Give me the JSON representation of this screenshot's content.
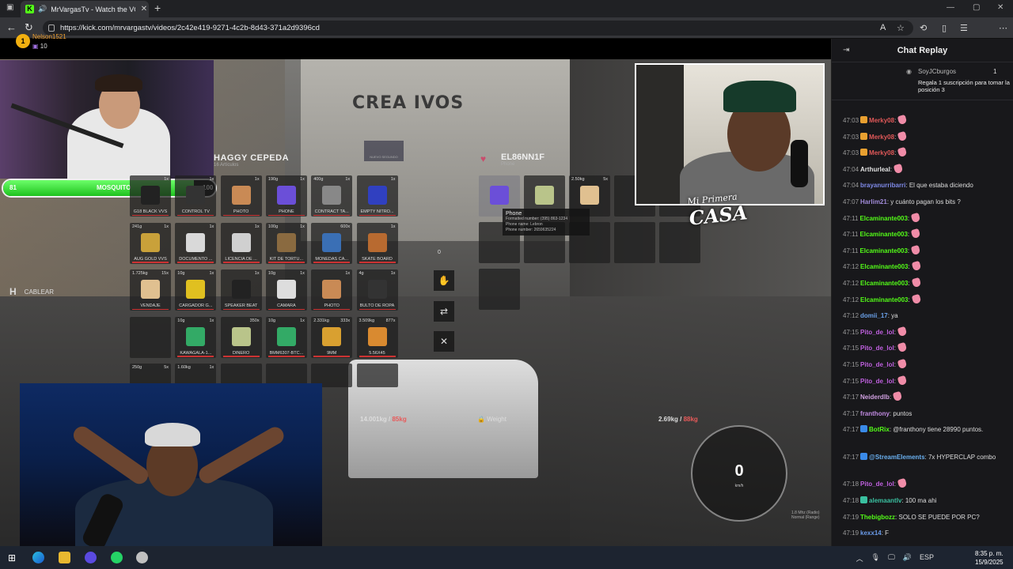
{
  "browser": {
    "tab_title": "MrVargasTv - Watch the VOD",
    "tab_close": "✕",
    "new_tab": "+",
    "url": "https://kick.com/mrvargastv/videos/2c42e419-9271-4c2b-8d43-371a2d9396cd",
    "win_min": "—",
    "win_max": "▢",
    "win_close": "✕"
  },
  "game": {
    "logo_text": "CREA IVOS",
    "health": {
      "left": "81",
      "name": "MOSQUITO",
      "right": "100",
      "level": 0.9
    },
    "hint": {
      "key": "H",
      "label": "CABLEAR"
    },
    "inventory": {
      "name": "HAGGY CEPEDA",
      "sub": "16 Artículos",
      "center_label": "NUEVO SEGUNDO",
      "slots": [
        {
          "wt": "",
          "qty": "1x",
          "lbl": "G18 BLACK VVS",
          "color": "#222"
        },
        {
          "wt": "",
          "qty": "1x",
          "lbl": "CONTROL TV",
          "color": "#333"
        },
        {
          "wt": "",
          "qty": "1x",
          "lbl": "PHOTO",
          "color": "#c98a55"
        },
        {
          "wt": "190g",
          "qty": "1x",
          "lbl": "PHONE",
          "color": "#6b4fd8"
        },
        {
          "wt": "400g",
          "qty": "1x",
          "lbl": "CONTRACT TA...",
          "color": "#888"
        },
        {
          "wt": "",
          "qty": "1x",
          "lbl": "EMPTY NITRO...",
          "color": "#3040c0"
        },
        {
          "wt": "241g",
          "qty": "1x",
          "lbl": "AUG GOLD VVS",
          "color": "#c9a13a"
        },
        {
          "wt": "",
          "qty": "1x",
          "lbl": "DOCUMENTO ...",
          "color": "#d9d9d9"
        },
        {
          "wt": "",
          "qty": "1x",
          "lbl": "LICENCIA DE ...",
          "color": "#d0d0d0"
        },
        {
          "wt": "100g",
          "qty": "1x",
          "lbl": "KIT DE TORTU...",
          "color": "#8a6a40"
        },
        {
          "wt": "",
          "qty": "600x",
          "lbl": "MONEDAS CA...",
          "color": "#3a6fb5"
        },
        {
          "wt": "",
          "qty": "1x",
          "lbl": "SKATE BOARD",
          "color": "#b86a30"
        },
        {
          "wt": "1.725kg",
          "qty": "15x",
          "lbl": "VENDAJE",
          "color": "#e0c090"
        },
        {
          "wt": "10g",
          "qty": "1x",
          "lbl": "CARGADOR G...",
          "color": "#e0c020"
        },
        {
          "wt": "",
          "qty": "1x",
          "lbl": "SPEAKER BEAT",
          "color": "#222"
        },
        {
          "wt": "10g",
          "qty": "1x",
          "lbl": "CAMARA",
          "color": "#ddd"
        },
        {
          "wt": "",
          "qty": "1x",
          "lbl": "PHOTO",
          "color": "#c98a55"
        },
        {
          "wt": "4g",
          "qty": "1x",
          "lbl": "BULTO DE ROPA",
          "color": "#333"
        },
        {
          "wt": "",
          "qty": "",
          "lbl": "",
          "color": ""
        },
        {
          "wt": "10g",
          "qty": "1x",
          "lbl": "KAWAGALA-1...",
          "color": "#3a6"
        },
        {
          "wt": "",
          "qty": "350x",
          "lbl": "DINERO",
          "color": "#b9c48a"
        },
        {
          "wt": "10g",
          "qty": "1x",
          "lbl": "BMM6307-BTC...",
          "color": "#3a6"
        },
        {
          "wt": "2.331kg",
          "qty": "333x",
          "lbl": "9MM",
          "color": "#d9a030"
        },
        {
          "wt": "3.509kg",
          "qty": "877x",
          "lbl": "5.56X45",
          "color": "#d98a30"
        },
        {
          "wt": "250g",
          "qty": "5x",
          "lbl": "",
          "color": ""
        },
        {
          "wt": "1.60kg",
          "qty": "1x",
          "lbl": "",
          "color": ""
        },
        {
          "wt": "",
          "qty": "",
          "lbl": "",
          "color": ""
        },
        {
          "wt": "",
          "qty": "",
          "lbl": "",
          "color": ""
        },
        {
          "wt": "",
          "qty": "",
          "lbl": "",
          "color": ""
        },
        {
          "wt": "",
          "qty": "",
          "lbl": "",
          "color": ""
        }
      ]
    },
    "ground": {
      "name": "EL86NN1F",
      "sub": "Phone",
      "slots": [
        {
          "wt": "",
          "qty": "",
          "lbl": "",
          "color": "#6b4fd8"
        },
        {
          "wt": "",
          "qty": "",
          "lbl": "",
          "color": "#b9c48a"
        },
        {
          "wt": "2.50kg",
          "qty": "5x",
          "lbl": "",
          "color": "#e0c090"
        }
      ]
    },
    "tooltip": {
      "title": "Phone",
      "line1": "Formatted number: (395) 863-1234",
      "line2": "Phone name: Lebron",
      "line3": "Phone number: 2659635224"
    },
    "amount": "0",
    "weight": {
      "left_val": "14.001kg",
      "left_max": "85kg",
      "mid_label": "Weight",
      "right_val": "2.69kg",
      "right_max": "88kg"
    },
    "speed": {
      "value": "0",
      "unit": "km/h"
    },
    "radio": {
      "line1": "1.8 Mhz (Radio)",
      "line2": "Normal (Range)"
    },
    "cam2_overlay": {
      "small": "Mi Primera",
      "big": "CASA"
    }
  },
  "chat": {
    "title": "Chat Replay",
    "pinned": {
      "rank": "1",
      "user": "Nelson1521",
      "count": "10",
      "user2": "SoyJCburgos",
      "count2": "1",
      "message": "Regala 1 suscripción para tomar la posición 3"
    },
    "messages": [
      {
        "time": "47:03",
        "user": "Merky08",
        "color": "#e05858",
        "text": ":",
        "emote": true,
        "badge": "#e8a030"
      },
      {
        "time": "47:03",
        "user": "Merky08",
        "color": "#e05858",
        "text": ":",
        "emote": true,
        "badge": "#e8a030"
      },
      {
        "time": "47:03",
        "user": "Merky08",
        "color": "#e05858",
        "text": ":",
        "emote": true,
        "badge": "#e8a030"
      },
      {
        "time": "47:04",
        "user": "Arthurleal",
        "color": "#e0e0e0",
        "text": ":",
        "emote": true,
        "badge": ""
      },
      {
        "time": "47:04",
        "user": "brayanurribarri",
        "color": "#7f8ae8",
        "text": ": El que estaba diciendo",
        "emote": false,
        "badge": ""
      },
      {
        "time": "47:07",
        "user": "Harlim21",
        "color": "#a08ad8",
        "text": ": y cuánto pagan los bits ?",
        "emote": false,
        "badge": ""
      },
      {
        "time": "47:11",
        "user": "Elcaminante003",
        "color": "#53fc18",
        "text": ":",
        "emote": true,
        "badge": ""
      },
      {
        "time": "47:11",
        "user": "Elcaminante003",
        "color": "#53fc18",
        "text": ":",
        "emote": true,
        "badge": ""
      },
      {
        "time": "47:11",
        "user": "Elcaminante003",
        "color": "#53fc18",
        "text": ":",
        "emote": true,
        "badge": ""
      },
      {
        "time": "47:12",
        "user": "Elcaminante003",
        "color": "#53fc18",
        "text": ":",
        "emote": true,
        "badge": ""
      },
      {
        "time": "47:12",
        "user": "Elcaminante003",
        "color": "#53fc18",
        "text": ":",
        "emote": true,
        "badge": ""
      },
      {
        "time": "47:12",
        "user": "Elcaminante003",
        "color": "#53fc18",
        "text": ":",
        "emote": true,
        "badge": ""
      },
      {
        "time": "47:12",
        "user": "domii_17",
        "color": "#6aa0e8",
        "text": ": ya",
        "emote": false,
        "badge": ""
      },
      {
        "time": "47:15",
        "user": "Pito_de_lol",
        "color": "#c060e0",
        "text": ":",
        "emote": true,
        "badge": ""
      },
      {
        "time": "47:15",
        "user": "Pito_de_lol",
        "color": "#c060e0",
        "text": ":",
        "emote": true,
        "badge": ""
      },
      {
        "time": "47:15",
        "user": "Pito_de_lol",
        "color": "#c060e0",
        "text": ":",
        "emote": true,
        "badge": ""
      },
      {
        "time": "47:15",
        "user": "Pito_de_lol",
        "color": "#c060e0",
        "text": ":",
        "emote": true,
        "badge": ""
      },
      {
        "time": "47:17",
        "user": "Neiderdlb",
        "color": "#d0a0e0",
        "text": ":",
        "emote": true,
        "badge": ""
      },
      {
        "time": "47:17",
        "user": "franthony",
        "color": "#c08ae0",
        "text": ": puntos",
        "emote": false,
        "badge": ""
      },
      {
        "time": "47:17",
        "user": "BotRix",
        "color": "#53fc18",
        "text": ": @franthony tiene 28990 puntos.",
        "emote": false,
        "badge": "#3a8ae8",
        "lines": 2
      },
      {
        "time": "47:17",
        "user": "@StreamElements",
        "color": "#6ab0f0",
        "text": ": 7x HYPERCLAP combo",
        "emote": false,
        "badge": "#3a8ae8",
        "lines": 2
      },
      {
        "time": "47:18",
        "user": "Pito_de_lol",
        "color": "#c060e0",
        "text": ":",
        "emote": true,
        "badge": ""
      },
      {
        "time": "47:18",
        "user": "alemaantlv",
        "color": "#3ac0a0",
        "text": ": 100 ma ahi",
        "emote": false,
        "badge": "#3ac0a0"
      },
      {
        "time": "47:19",
        "user": "Thebigbozz",
        "color": "#53fc18",
        "text": ": SOLO SE PUEDE POR PC?",
        "emote": false,
        "badge": ""
      },
      {
        "time": "47:19",
        "user": "kexx14",
        "color": "#6a9ae8",
        "text": ": F",
        "emote": false,
        "badge": ""
      }
    ]
  },
  "taskbar": {
    "lang": "ESP",
    "time": "8:35 p. m.",
    "date": "15/9/2025"
  }
}
